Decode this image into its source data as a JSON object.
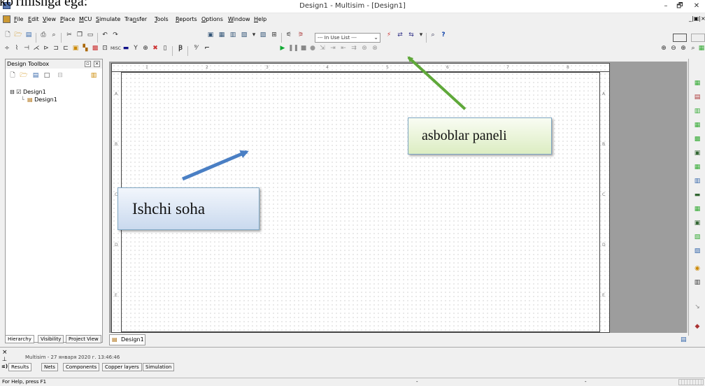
{
  "doc_snippet": "ko'rinishga ega:",
  "window": {
    "title": "Design1 - Multisim - [Design1]",
    "minimize": "–",
    "maximize": "🗗",
    "close": "✕",
    "mdi_buttons": "_|▣|×"
  },
  "menu": [
    {
      "label": "File",
      "u": "F",
      "rest": "ile"
    },
    {
      "label": "Edit",
      "u": "E",
      "rest": "dit"
    },
    {
      "label": "View",
      "u": "V",
      "rest": "iew"
    },
    {
      "label": "Place",
      "u": "P",
      "rest": "lace"
    },
    {
      "label": "MCU",
      "u": "M",
      "rest": "CU"
    },
    {
      "label": "Simulate",
      "u": "S",
      "rest": "imulate"
    },
    {
      "label": "Transfer",
      "pre": "Tra",
      "u": "n",
      "rest": "sfer"
    },
    {
      "label": "Tools",
      "u": "T",
      "rest": "ools"
    },
    {
      "label": "Reports",
      "u": "R",
      "rest": "eports"
    },
    {
      "label": "Options",
      "u": "O",
      "rest": "ptions"
    },
    {
      "label": "Window",
      "u": "W",
      "rest": "indow"
    },
    {
      "label": "Help",
      "u": "H",
      "rest": "elp"
    }
  ],
  "toolbar": {
    "in_use_list": "--- In Use List ---"
  },
  "design_toolbox": {
    "title": "Design Toolbox",
    "tree_root": "Design1",
    "tree_child": "Design1",
    "tabs": [
      "Hierarchy",
      "Visibility",
      "Project View"
    ]
  },
  "workspace": {
    "tab": "Design1",
    "col_labels": [
      "1",
      "2",
      "3",
      "4",
      "5",
      "6",
      "7",
      "8"
    ],
    "row_labels": [
      "A",
      "B",
      "C",
      "D",
      "E"
    ]
  },
  "results": {
    "log": "Multisim  -  27 января 2020 г. 13:46:46",
    "tabs": [
      "Results",
      "Nets",
      "Components",
      "Copper layers",
      "Simulation"
    ]
  },
  "status": {
    "text": "For Help, press F1",
    "dash": "-"
  },
  "callouts": {
    "toolbar_label": "asboblar paneli",
    "workspace_label": "Ishchi soha"
  },
  "colors": {
    "green_arrow": "#5fa83a",
    "blue_arrow": "#4a7fc4",
    "green_box": "#dcedc2",
    "blue_box": "#c9d9ee"
  }
}
